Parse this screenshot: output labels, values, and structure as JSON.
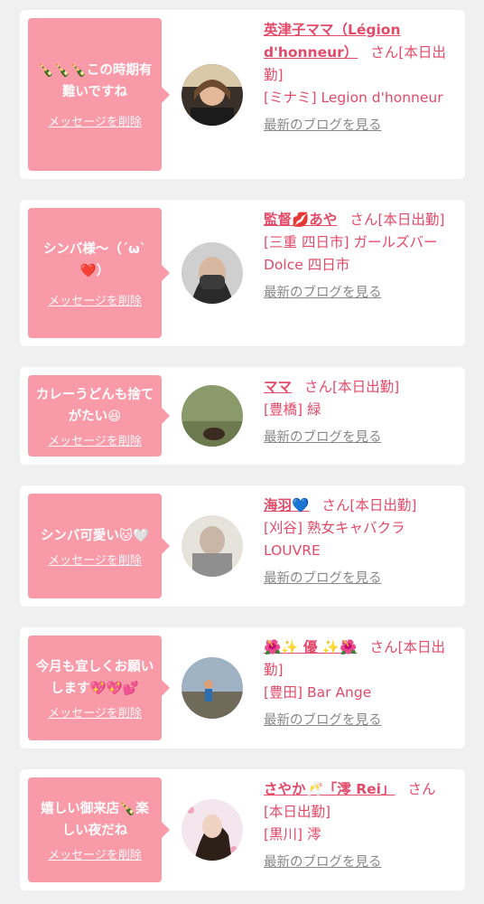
{
  "delete_label": "メッセージを削除",
  "blog_label": "最新のブログを見る",
  "san_label": "さん[本日出勤]",
  "colors": {
    "bubble": "#f99aa8",
    "accent": "#e24a6a",
    "muted": "#888888",
    "card": "#ffffff",
    "page": "#f0f0f0"
  },
  "cards": [
    {
      "message": "🍾🍾🍾この時期有難いですね",
      "name": "英津子ママ（Légion d'honneur）",
      "shop": "[ミナミ] Legion d'honneur"
    },
    {
      "message": "シンバ様〜（´ω`❤️）",
      "name": "監督💋あや",
      "shop": "[三重 四日市] ガールズバー Dolce 四日市"
    },
    {
      "message": "カレーうどんも捨てがたい😆",
      "name": "ママ",
      "shop": "[豊橋] 緑"
    },
    {
      "message": "シンバ可愛い🐱🤍",
      "name": "海羽💙",
      "shop": "[刈谷] 熟女キャバクラ LOUVRE"
    },
    {
      "message": "今月も宜しくお願いします💖💖💕",
      "name": "🌺✨ 優 ✨🌺",
      "shop": "[豊田] Bar Ange"
    },
    {
      "message": "嬉しい御来店🍾楽しい夜だね",
      "name": "さやか🥂「澪 Rei」",
      "shop": "[黒川] 澪"
    }
  ]
}
